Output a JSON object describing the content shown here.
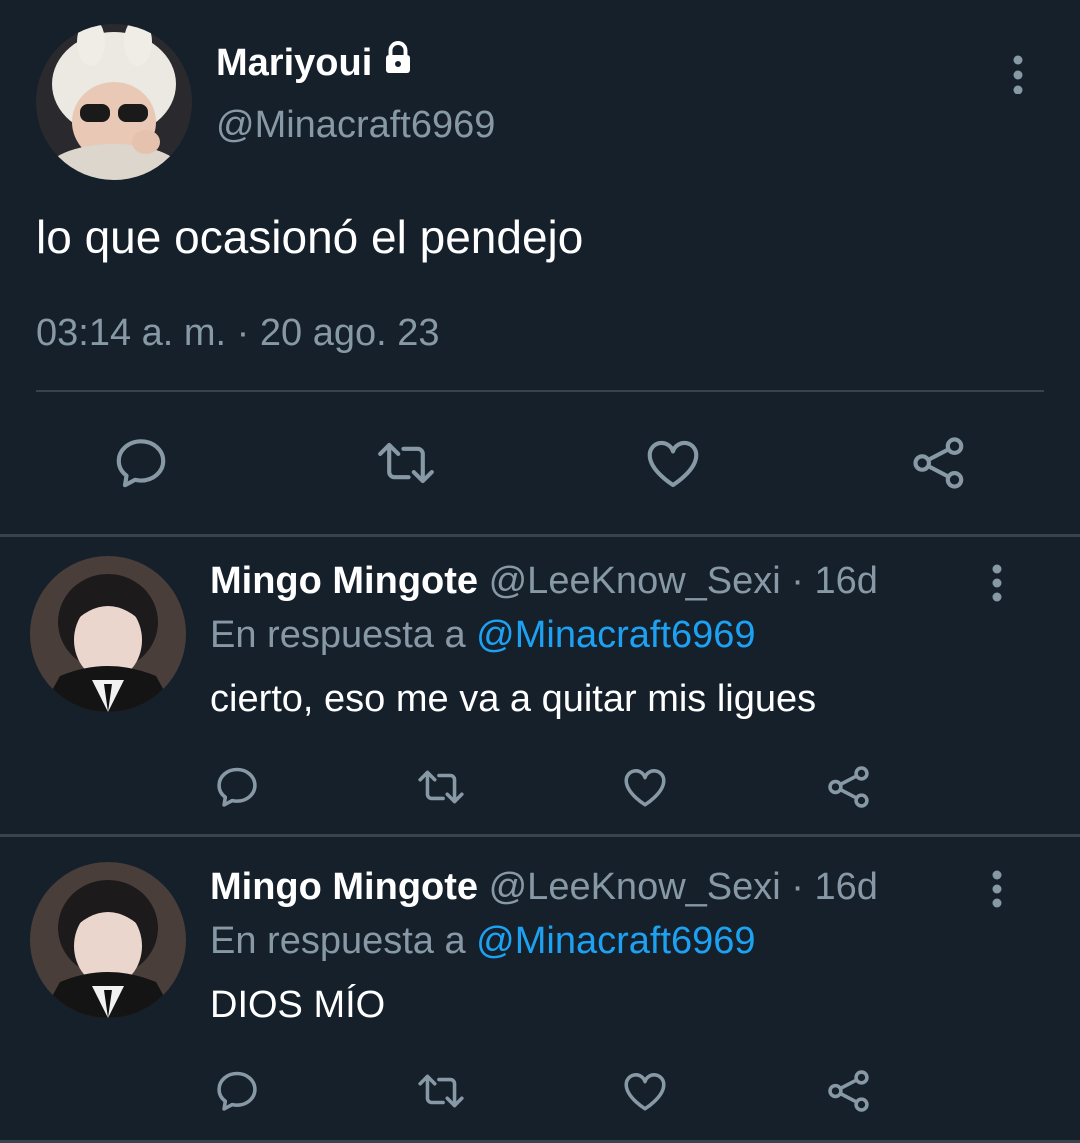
{
  "main_tweet": {
    "author_name": "Mariyoui",
    "author_handle": "@Minacraft6969",
    "text": "lo que ocasionó el pendejo",
    "timestamp": "03:14 a. m. · 20 ago. 23",
    "icons": {
      "lock": "lock-icon",
      "more": "more-vertical-icon",
      "reply": "reply-icon",
      "retweet": "retweet-icon",
      "like": "heart-icon",
      "share": "share-icon"
    }
  },
  "replies": [
    {
      "author_name": "Mingo Mingote",
      "author_handle": "@LeeKnow_Sexi",
      "time_ago": "16d",
      "reply_prefix": "En respuesta a",
      "reply_mention": "@Minacraft6969",
      "text": "cierto, eso me va a quitar mis ligues"
    },
    {
      "author_name": "Mingo Mingote",
      "author_handle": "@LeeKnow_Sexi",
      "time_ago": "16d",
      "reply_prefix": "En respuesta a",
      "reply_mention": "@Minacraft6969",
      "text": "DIOS MÍO"
    }
  ],
  "colors": {
    "background": "#15202b",
    "primary_text": "#ffffff",
    "secondary_text": "#8899a6",
    "mention": "#1da1f2",
    "divider": "#38444d"
  }
}
